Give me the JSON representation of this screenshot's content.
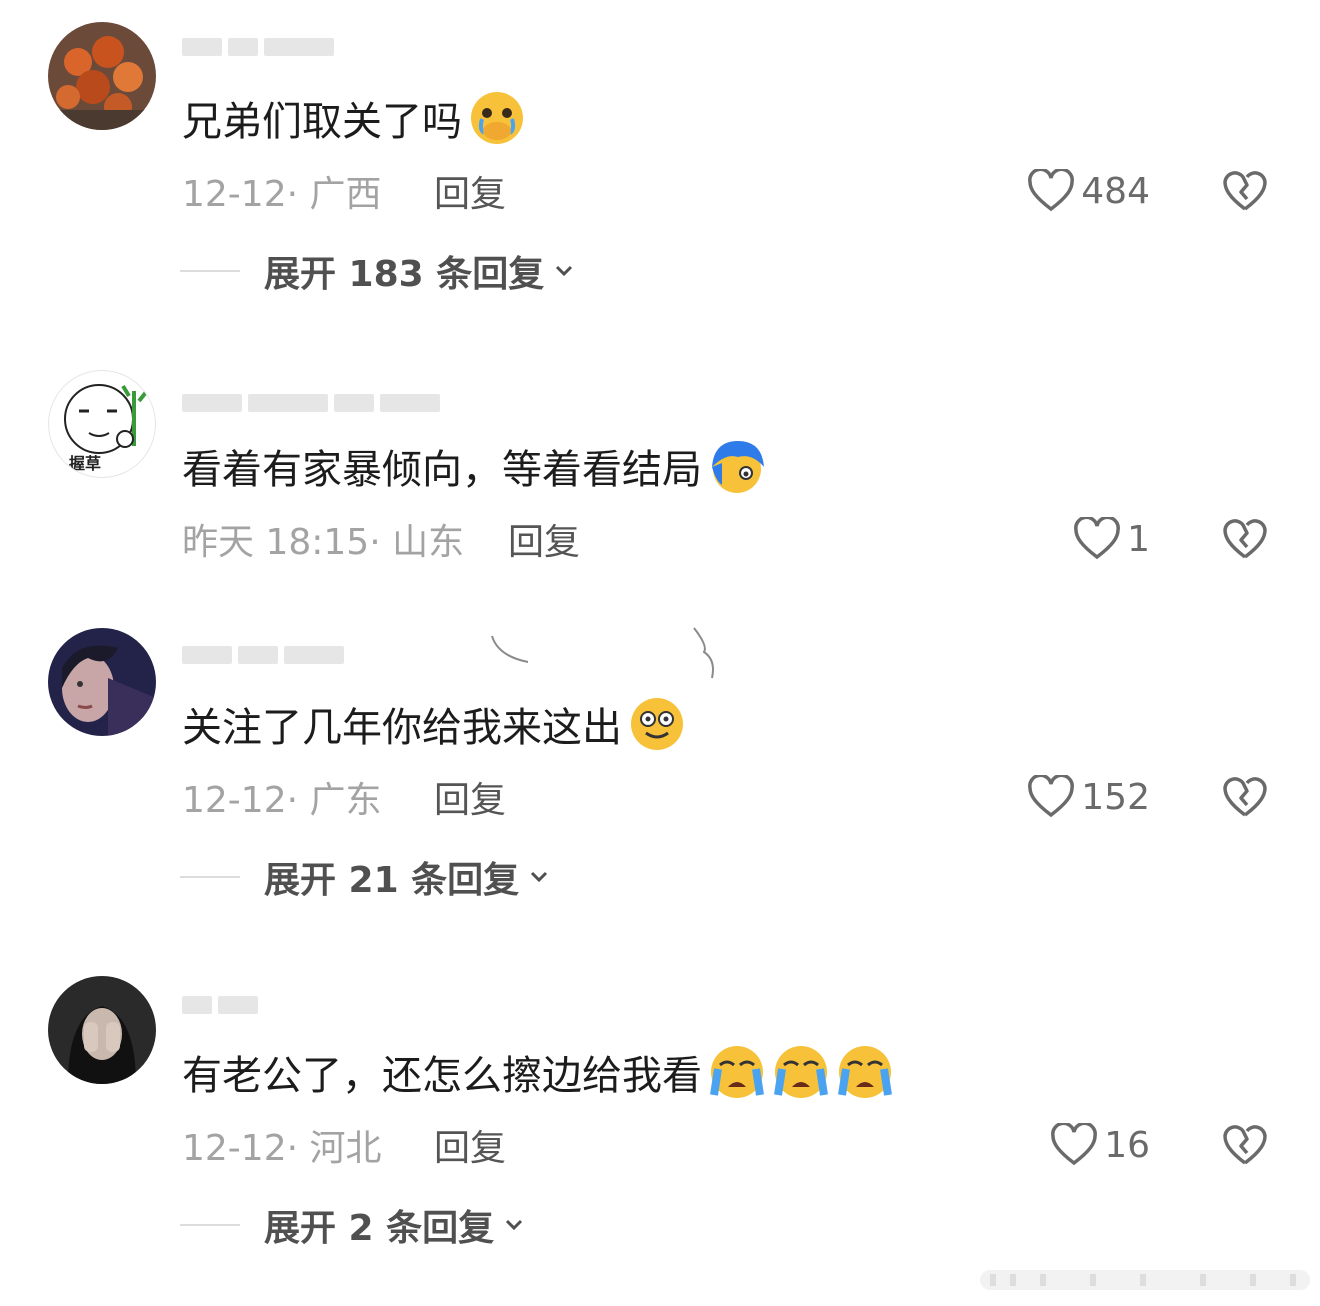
{
  "comments": [
    {
      "text": "兄弟们取关了吗",
      "emoji_icons": [
        "hand-over-mouth-crying-emoji"
      ],
      "date_location": "12-12· 广西",
      "reply_label": "回复",
      "likes": "484",
      "expand_label": "展开 183 条回复"
    },
    {
      "text": "看着有家暴倾向，等着看结局",
      "emoji_icons": [
        "blue-hair-peeking-emoji"
      ],
      "date_location": "昨天 18:15· 山东",
      "reply_label": "回复",
      "likes": "1",
      "avatar_caption": "握草"
    },
    {
      "text": "关注了几年你给我来这出",
      "emoji_icons": [
        "dizzy-face-emoji"
      ],
      "date_location": "12-12· 广东",
      "reply_label": "回复",
      "likes": "152",
      "expand_label": "展开 21 条回复"
    },
    {
      "text": "有老公了，还怎么擦边给我看",
      "emoji_icons": [
        "loudly-crying-emoji",
        "loudly-crying-emoji",
        "loudly-crying-emoji"
      ],
      "date_location": "12-12· 河北",
      "reply_label": "回复",
      "likes": "16",
      "expand_label": "展开 2 条回复"
    }
  ],
  "colors": {
    "text": "#1c1c1c",
    "meta": "#a3a3a3",
    "icon": "#6a6a6a",
    "emoji_yellow": "#f7c23a",
    "tear_blue": "#4aa3f0"
  }
}
